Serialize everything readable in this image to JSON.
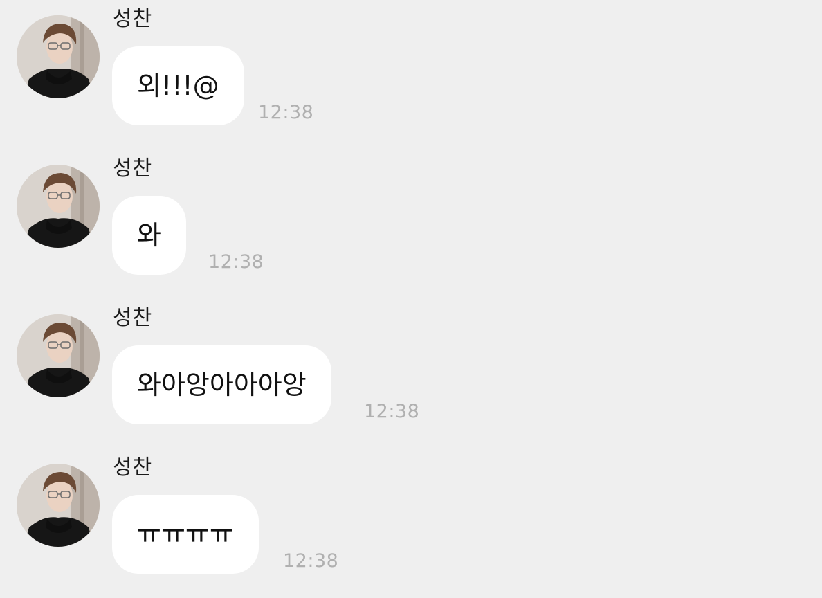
{
  "messages": [
    {
      "sender": "성찬",
      "text": "외!!!@",
      "time": "12:38",
      "avatar_icon": "profile-photo"
    },
    {
      "sender": "성찬",
      "text": "와",
      "time": "12:38",
      "avatar_icon": "profile-photo"
    },
    {
      "sender": "성찬",
      "text": "와아앙아아아앙",
      "time": "12:38",
      "avatar_icon": "profile-photo"
    },
    {
      "sender": "성찬",
      "text": "ㅠㅠㅠㅠ",
      "time": "12:38",
      "avatar_icon": "profile-photo"
    }
  ],
  "colors": {
    "background": "#efefef",
    "bubble": "#ffffff",
    "timestamp": "#b0b0b0"
  }
}
